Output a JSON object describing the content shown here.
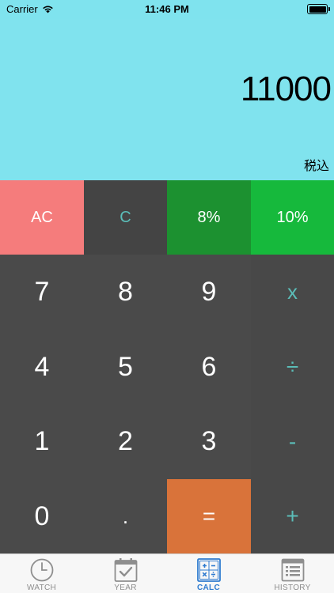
{
  "status": {
    "carrier": "Carrier",
    "time": "11:46 PM"
  },
  "display": {
    "value": "11000",
    "tax_label": "税込"
  },
  "keys": {
    "ac": "AC",
    "c": "C",
    "p8": "8%",
    "p10": "10%",
    "n7": "7",
    "n8": "8",
    "n9": "9",
    "mul": "x",
    "n4": "4",
    "n5": "5",
    "n6": "6",
    "div": "÷",
    "n1": "1",
    "n2": "2",
    "n3": "3",
    "sub": "-",
    "n0": "0",
    "dot": ".",
    "eq": "=",
    "add": "+"
  },
  "tabs": [
    {
      "label": "WATCH",
      "icon": "clock-icon"
    },
    {
      "label": "YEAR",
      "icon": "calendar-check-icon"
    },
    {
      "label": "CALC",
      "icon": "calculator-icon",
      "active": true
    },
    {
      "label": "HISTORY",
      "icon": "history-list-icon"
    }
  ],
  "colors": {
    "display_bg": "#80e3ee",
    "ac": "#f57c7c",
    "c": "#444444",
    "p8": "#1c9130",
    "p10": "#16b93c",
    "equals": "#d9733a",
    "digit_bg": "#4a4a4a",
    "operator_text": "#5bbdb8",
    "tab_active": "#2f7bd0"
  }
}
